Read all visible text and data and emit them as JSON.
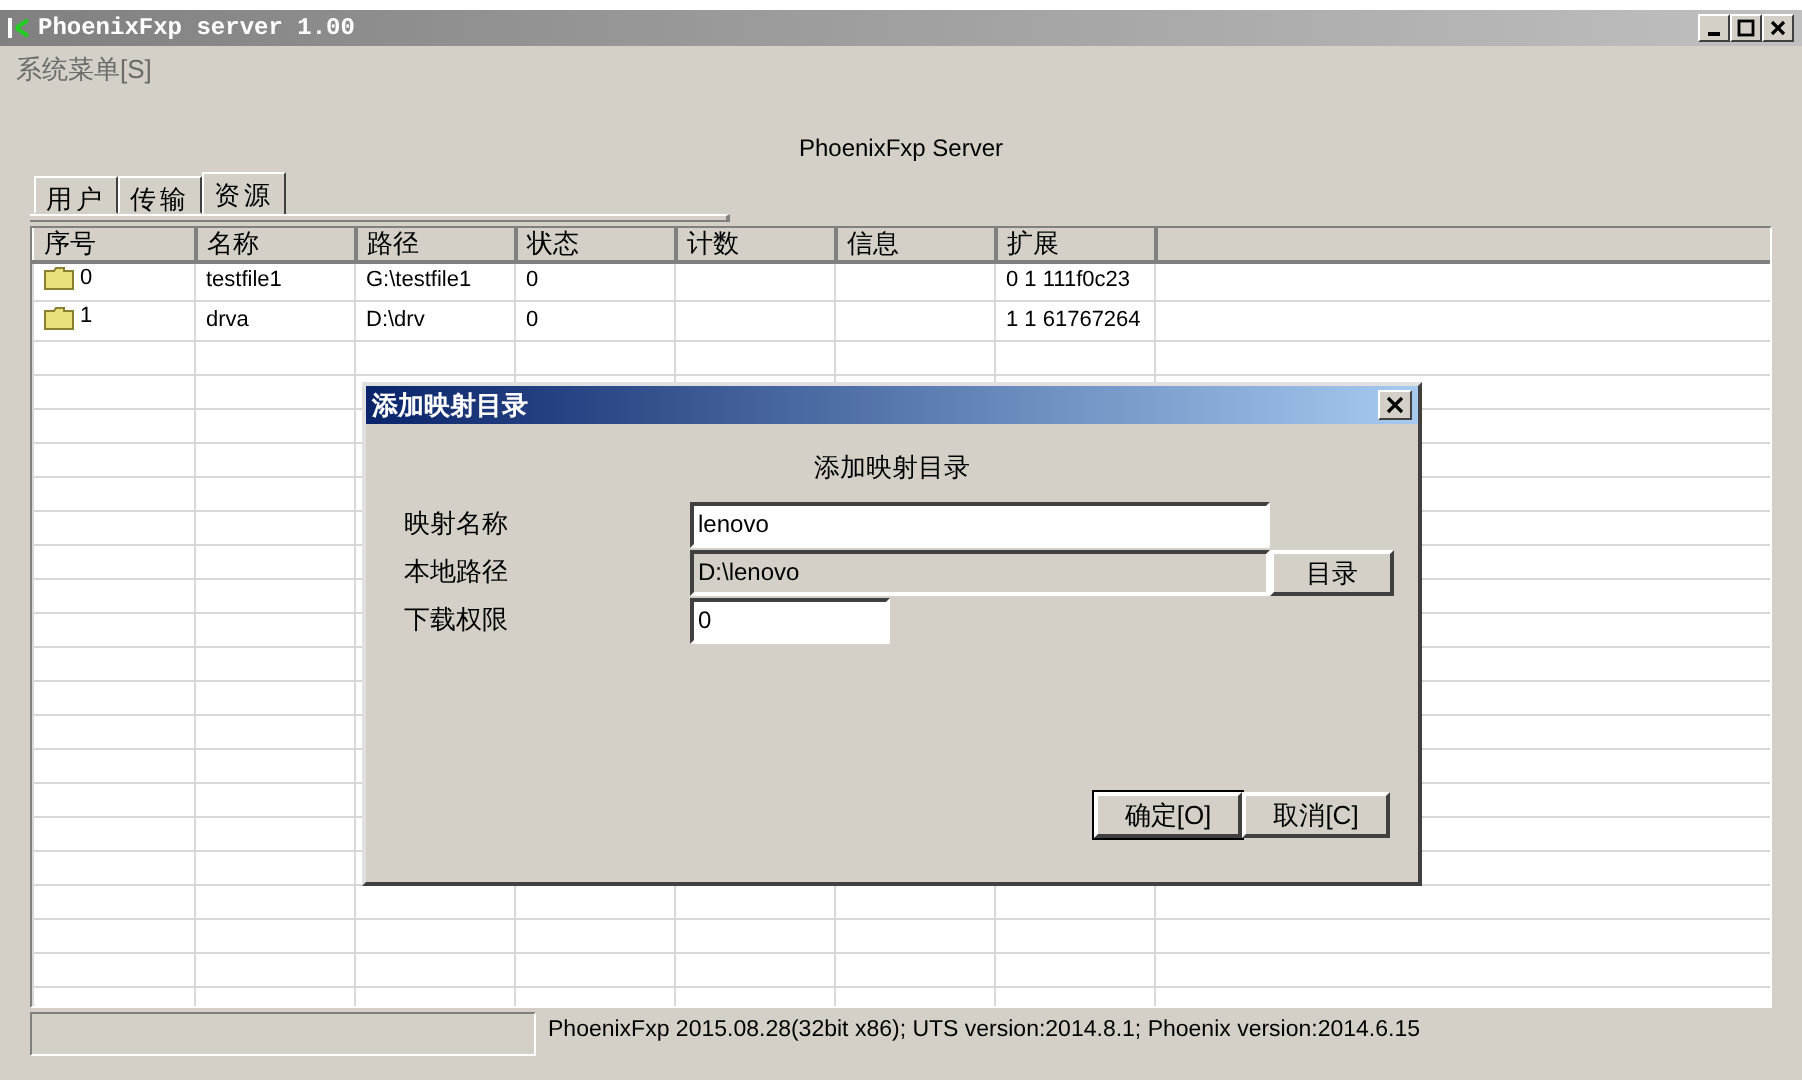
{
  "window": {
    "title": "PhoenixFxp server 1.00"
  },
  "menu": [
    "系统菜单[S]"
  ],
  "header": "PhoenixFxp Server",
  "tabs": [
    {
      "label": "用户",
      "selected": false
    },
    {
      "label": "传输",
      "selected": false
    },
    {
      "label": "资源",
      "selected": true
    }
  ],
  "table": {
    "columns": [
      "序号",
      "名称",
      "路径",
      "状态",
      "计数",
      "信息",
      "扩展"
    ],
    "rows": [
      {
        "cells": [
          "0",
          "testfile1",
          "G:\\testfile1",
          "0",
          "",
          "",
          "0 1 111f0c23"
        ]
      },
      {
        "cells": [
          "1",
          "drva",
          "D:\\drv",
          "0",
          "",
          "",
          "1 1 61767264"
        ]
      }
    ]
  },
  "status_bar": {
    "text": "PhoenixFxp 2015.08.28(32bit x86); UTS version:2014.8.1; Phoenix version:2014.6.15"
  },
  "dialog": {
    "title": "添加映射目录",
    "heading": "添加映射目录",
    "fields": [
      {
        "label": "映射名称",
        "value": "lenovo",
        "disabled": false
      },
      {
        "label": "本地路径",
        "value": "D:\\lenovo",
        "disabled": true
      },
      {
        "label": "下载权限",
        "value": "0",
        "disabled": false
      }
    ],
    "browse_button": "目录",
    "buttons": [
      {
        "label": "确定[O]",
        "default": true
      },
      {
        "label": "取消[C]",
        "default": false
      }
    ]
  }
}
